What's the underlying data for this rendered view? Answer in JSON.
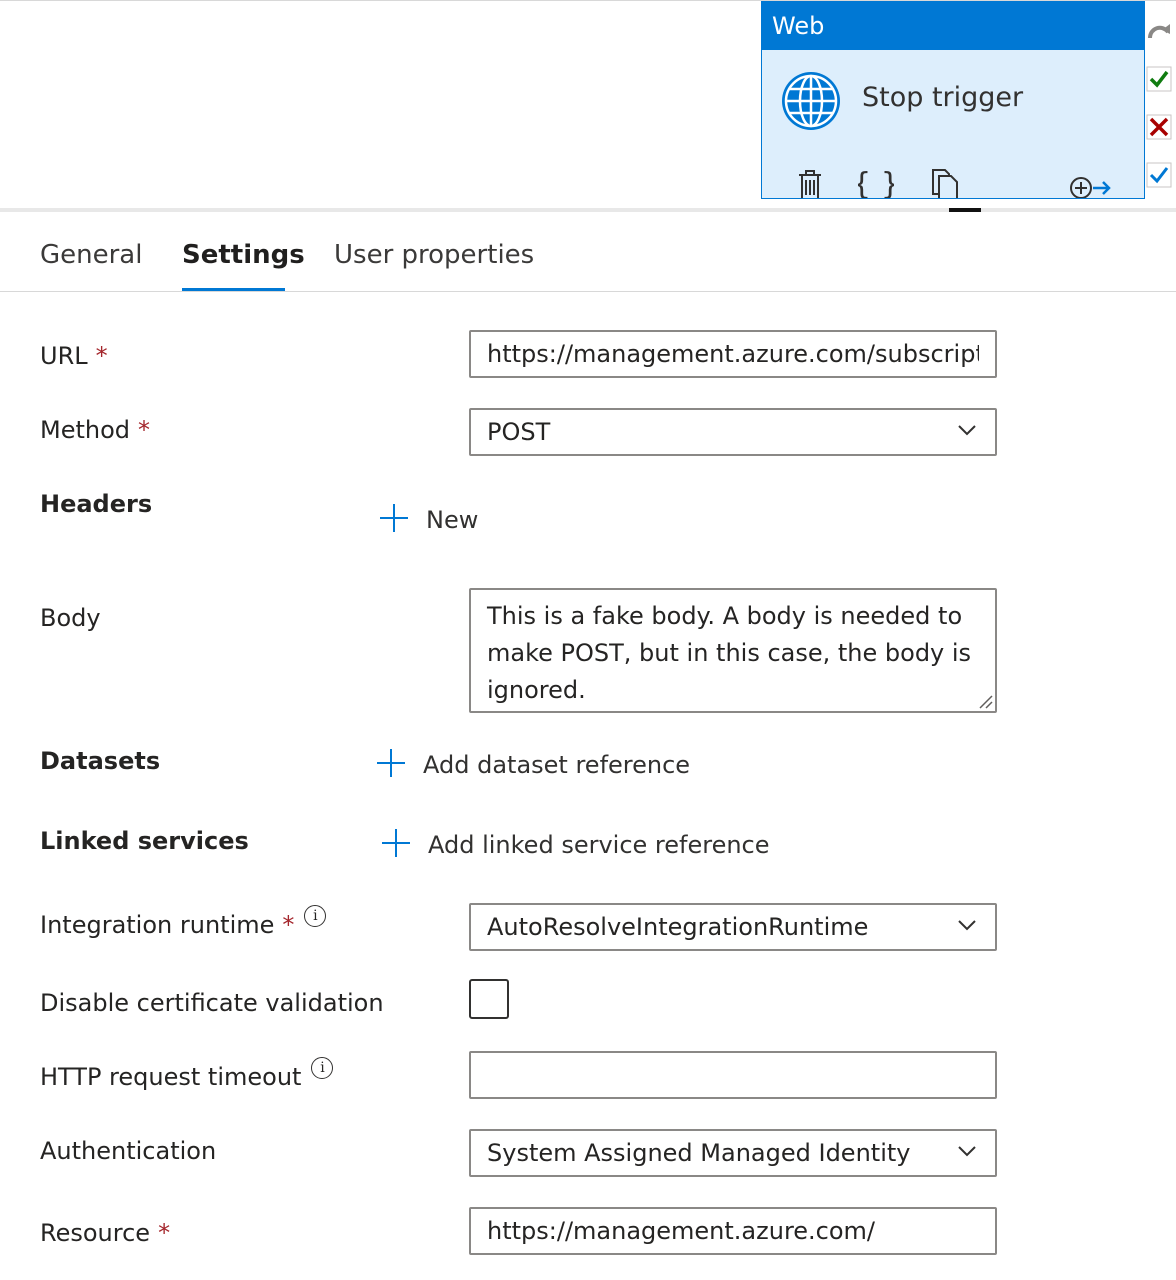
{
  "activity": {
    "type_label": "Web",
    "name": "Stop trigger",
    "toolbar": [
      "delete-icon",
      "code-icon",
      "copy-icon",
      "add-output-icon"
    ]
  },
  "side_tools": [
    "redo-icon",
    "validate-icon",
    "cancel-icon",
    "checkbox-checked-icon"
  ],
  "tabs": [
    {
      "label": "General",
      "active": false
    },
    {
      "label": "Settings",
      "active": true
    },
    {
      "label": "User properties",
      "active": false
    }
  ],
  "form": {
    "url": {
      "label": "URL",
      "required": "*",
      "value": "https://management.azure.com/subscriptio"
    },
    "method": {
      "label": "Method",
      "required": "*",
      "value": "POST"
    },
    "headers": {
      "label": "Headers",
      "action": "New"
    },
    "body": {
      "label": "Body",
      "value": "This is a fake body.  A body is needed to make POST, but in this case, the body is ignored."
    },
    "datasets": {
      "label": "Datasets",
      "action": "Add dataset reference"
    },
    "linked_services": {
      "label": "Linked services",
      "action": "Add linked service reference"
    },
    "integration_runtime": {
      "label": "Integration runtime",
      "required": "*",
      "info": "i",
      "value": "AutoResolveIntegrationRuntime"
    },
    "disable_cert": {
      "label": "Disable certificate validation",
      "checked": false
    },
    "http_timeout": {
      "label": "HTTP request timeout",
      "info": "i",
      "value": ""
    },
    "authentication": {
      "label": "Authentication",
      "value": "System Assigned Managed Identity"
    },
    "resource": {
      "label": "Resource",
      "required": "*",
      "value": "https://management.azure.com/"
    }
  },
  "colors": {
    "accent": "#0078d4",
    "activity_bg": "#ddeefc",
    "required": "#a4262c",
    "validate": "#107c10",
    "error": "#a80000"
  }
}
